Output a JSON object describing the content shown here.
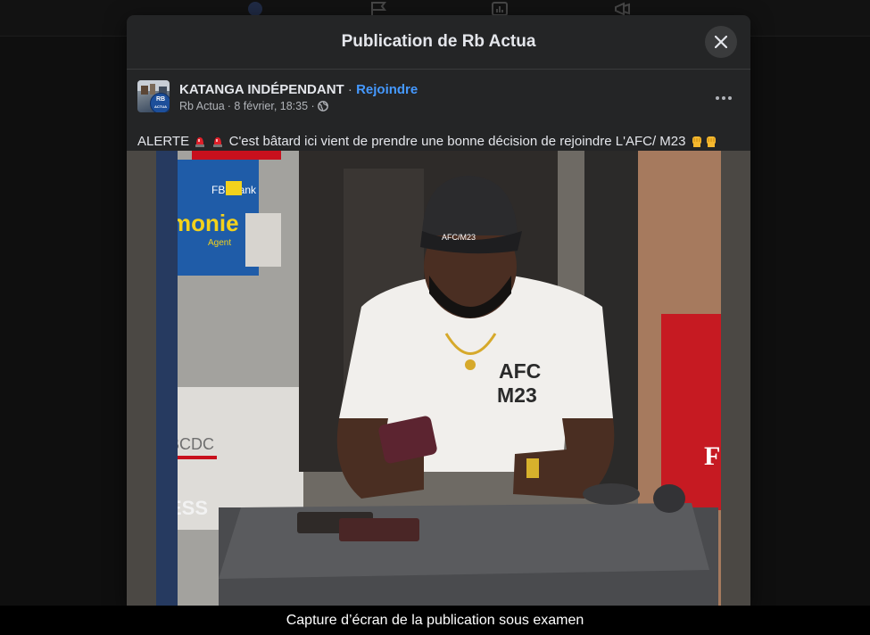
{
  "modal": {
    "title": "Publication de Rb Actua",
    "close_icon": "close-icon"
  },
  "post": {
    "group_name": "KATANGA INDÉPENDANT",
    "separator": " · ",
    "join_label": "Rejoindre",
    "author": "Rb Actua",
    "date": " · 8 février, 18:35 · ",
    "privacy_icon": "globe-icon",
    "more_icon": "more-options-icon",
    "avatar_badge_top": "RB",
    "avatar_badge_bottom": "ACTUA",
    "text_alert": "ALERTE",
    "text_body": " C'est bâtard ici vient de prendre une bonne décision de rejoindre L'AFC/ M23 ",
    "alert_emoji": "police-light-emoji",
    "fist_emoji": "raised-fist-emoji"
  },
  "photo": {
    "shop_sign_brand": "monie",
    "shop_sign_sub": "Agent",
    "shop_sign_bank": "FBNbank",
    "bank_label": "BCDC",
    "wall_text": "ESS",
    "cap_text": "AFC/M23",
    "shirt_line1": "AFC",
    "shirt_line2": "M23",
    "red_sign_letter": "F"
  },
  "caption": "Capture d’écran de la publication sous examen",
  "colors": {
    "modal_bg": "#242526",
    "accent_link": "#4599ff",
    "text_primary": "#e4e6eb",
    "text_secondary": "#b0b3b8"
  }
}
